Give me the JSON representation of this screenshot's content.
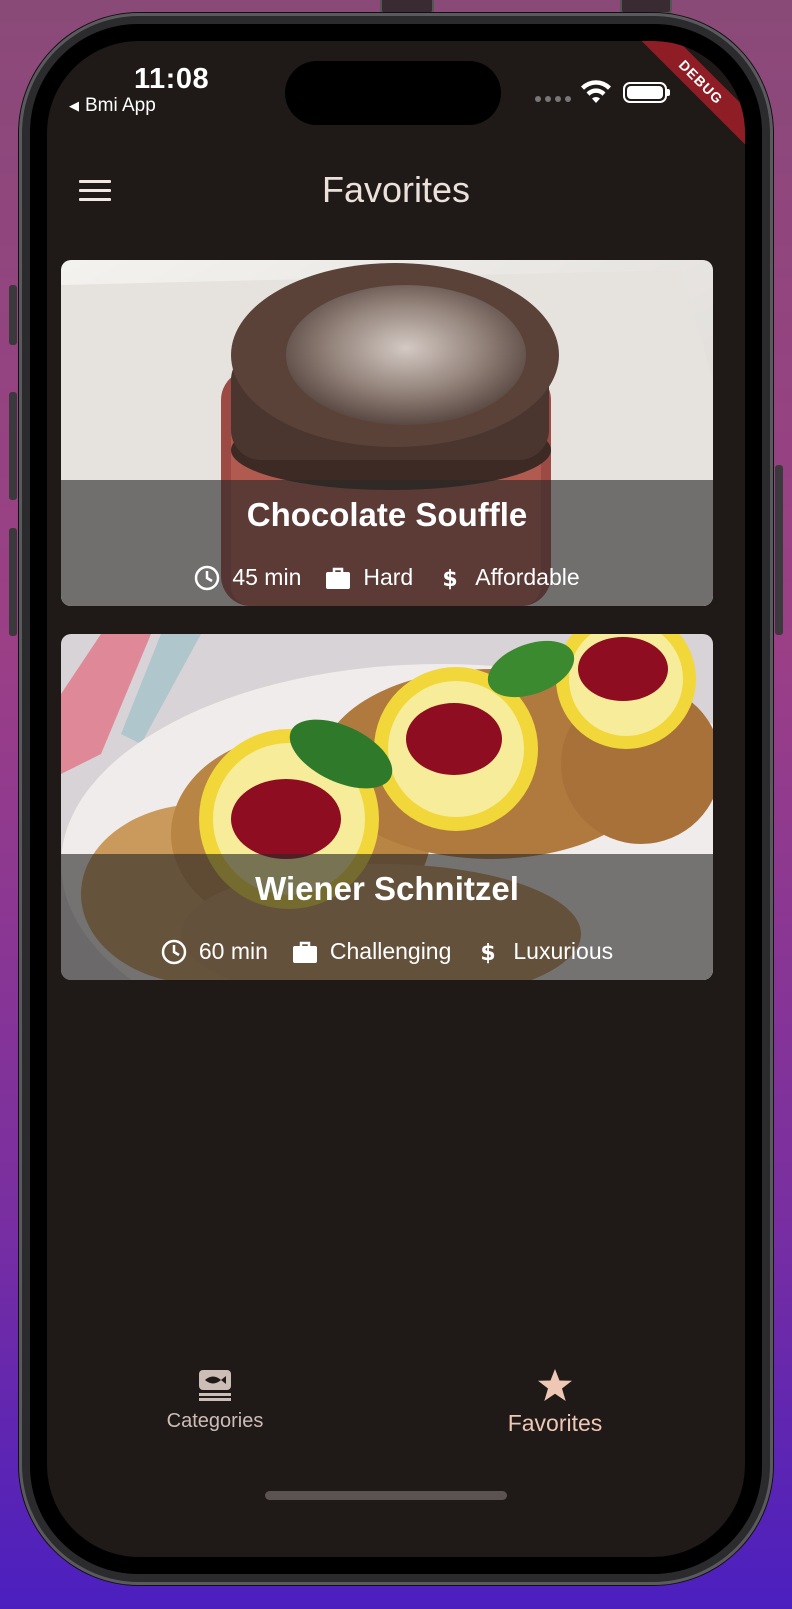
{
  "status_bar": {
    "time": "11:08",
    "back_app": "Bmi App",
    "debug_label": "DEBUG"
  },
  "appbar": {
    "title": "Favorites",
    "menu_icon": "hamburger-menu-icon"
  },
  "meals": [
    {
      "title": "Chocolate Souffle",
      "duration": "45 min",
      "complexity": "Hard",
      "affordability": "Affordable"
    },
    {
      "title": "Wiener Schnitzel",
      "duration": "60 min",
      "complexity": "Challenging",
      "affordability": "Luxurious"
    }
  ],
  "bottom_nav": {
    "items": [
      {
        "label": "Categories",
        "icon": "set-meal-icon",
        "selected": false
      },
      {
        "label": "Favorites",
        "icon": "star-icon",
        "selected": true
      }
    ]
  },
  "colors": {
    "background": "#1f1917",
    "selected_nav": "#efc7b5",
    "unselected_nav": "#cdbdb7",
    "debug_banner": "#8e1d25"
  }
}
